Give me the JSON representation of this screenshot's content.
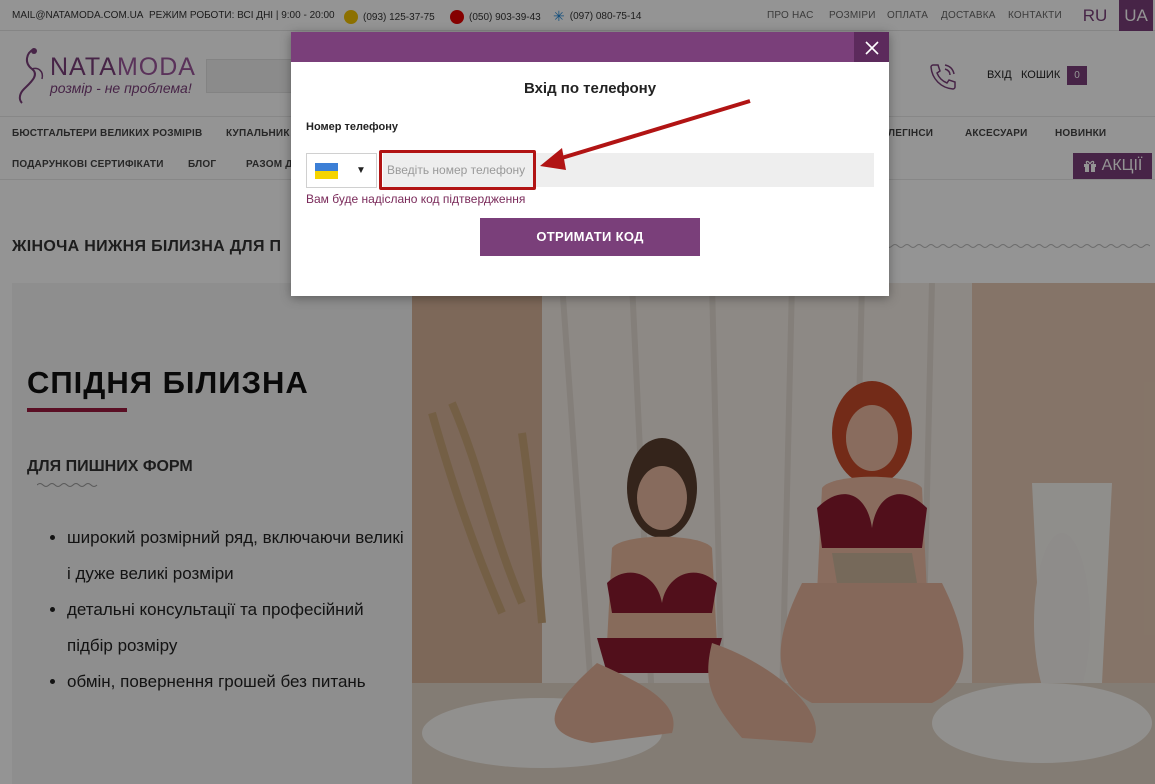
{
  "topbar": {
    "email": "MAIL@NATAMODA.COM.UA",
    "schedule": "РЕЖИМ РОБОТИ: ВСІ ДНІ | 9:00 - 20:00",
    "phones": [
      {
        "number": "(093) 125-37-75",
        "operator_icon": "lifecell-icon"
      },
      {
        "number": "(050) 903-39-43",
        "operator_icon": "vodafone-icon"
      },
      {
        "number": "(097) 080-75-14",
        "operator_icon": "kyivstar-icon"
      }
    ],
    "links": [
      "ПРО НАС",
      "РОЗМІРИ",
      "ОПЛАТА",
      "ДОСТАВКА",
      "КОНТАКТИ"
    ],
    "lang_ru": "RU",
    "lang_ua": "UA"
  },
  "header": {
    "logo_nata": "NATA",
    "logo_moda": "MODA",
    "slogan": "розмір - не проблема!",
    "login": "ВХІД",
    "cart": "КОШИК",
    "cart_count": "0"
  },
  "nav": {
    "row1": [
      "БЮСТГАЛЬТЕРИ ВЕЛИКИХ РОЗМІРІВ",
      "КУПАЛЬНИК",
      "ЛЕГІНСИ",
      "АКСЕСУАРИ",
      "НОВИНКИ"
    ],
    "row2": [
      "ПОДАРУНКОВІ СЕРТИФІКАТИ",
      "БЛОГ",
      "РАЗОМ Д"
    ],
    "sales": "АКЦІЇ"
  },
  "page": {
    "title": "ЖІНОЧА НИЖНЯ БІЛИЗНА ДЛЯ П",
    "promo_heading": "СПІДНЯ БІЛИЗНА",
    "promo_sub": "ДЛЯ ПИШНИХ ФОРМ",
    "bullets": [
      "широкий розмірний ряд, включаючи великі і дуже великі розміри",
      "детальні консультації та професійний підбір розміру",
      "обмін, повернення грошей без питань"
    ]
  },
  "modal": {
    "title": "Вхід по телефону",
    "field_label": "Номер телефону",
    "phone_placeholder": "Введіть номер телефону",
    "phone_value": "",
    "hint": "Вам буде надіслано код підтвердження",
    "button": "ОТРИМАТИ КОД",
    "close_icon": "close-icon",
    "country_flag": "ukraine-flag-icon"
  },
  "colors": {
    "brand": "#7a3f7a",
    "highlight": "#b11414"
  }
}
